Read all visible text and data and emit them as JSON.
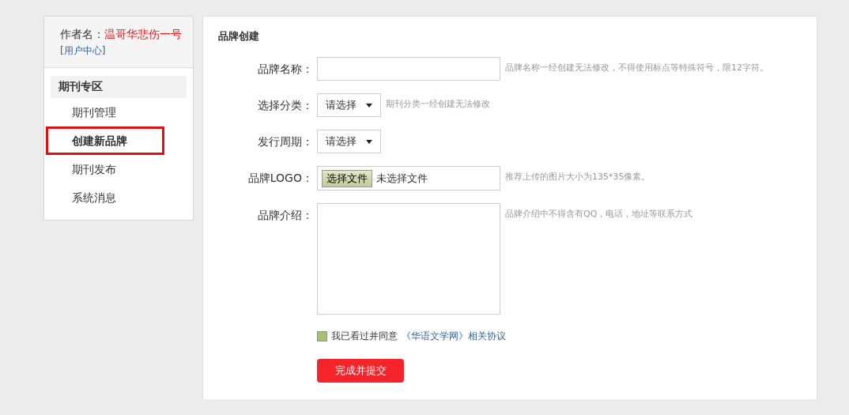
{
  "sidebar": {
    "author_label": "作者名：",
    "author_name": "温哥华悲伤一号",
    "user_center_link": "[用户中心]",
    "section_title": "期刊专区",
    "items": [
      {
        "label": "期刊管理",
        "selected": false
      },
      {
        "label": "创建新品牌",
        "selected": true
      },
      {
        "label": "期刊发布",
        "selected": false
      },
      {
        "label": "系统消息",
        "selected": false
      }
    ]
  },
  "form": {
    "title": "品牌创建",
    "fields": [
      {
        "kind": "text",
        "label": "品牌名称：",
        "hint": "品牌名称一经创建无法修改，不得使用标点等特殊符号，限12字符。"
      },
      {
        "kind": "select",
        "label": "选择分类：",
        "value": "请选择",
        "hint": "期刊分类一经创建无法修改"
      },
      {
        "kind": "select",
        "label": "发行周期：",
        "value": "请选择"
      },
      {
        "kind": "file",
        "label": "品牌LOGO：",
        "button": "选择文件",
        "value": "未选择文件",
        "hint": "推荐上传的图片大小为135*35像素。"
      },
      {
        "kind": "textarea",
        "label": "品牌介绍：",
        "hint": "品牌介绍中不得含有QQ，电话，地址等联系方式"
      }
    ],
    "agreement": {
      "checked": false,
      "text": "我已看过并同意",
      "link": "《华语文学网》相关协议"
    },
    "submit": "完成并提交"
  }
}
